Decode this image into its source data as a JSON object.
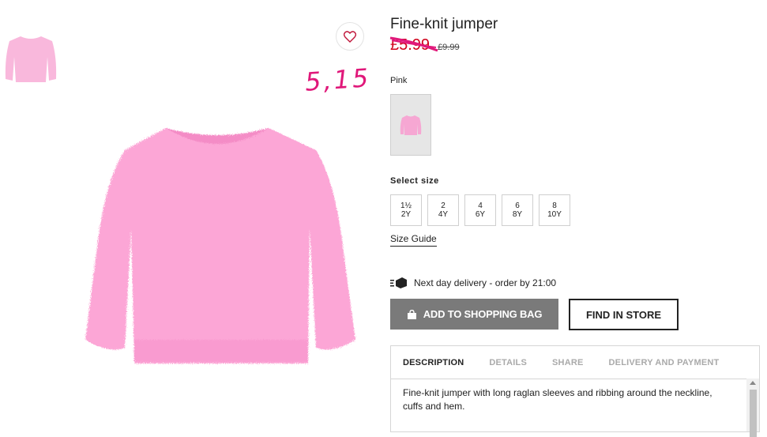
{
  "product": {
    "title": "Fine-knit jumper",
    "price_new": "£5.99",
    "price_old": "£9.99",
    "handwritten_note": "5,15",
    "color_name": "Pink",
    "accent_color": "#d0021b",
    "note_color": "#e0187a"
  },
  "size": {
    "label": "Select size",
    "options": [
      {
        "line1": "1½",
        "line2": "2Y"
      },
      {
        "line1": "2",
        "line2": "4Y"
      },
      {
        "line1": "4",
        "line2": "6Y"
      },
      {
        "line1": "6",
        "line2": "8Y"
      },
      {
        "line1": "8",
        "line2": "10Y"
      }
    ],
    "guide": "Size Guide"
  },
  "delivery": {
    "text": "Next day delivery - order by 21:00",
    "icon": "truck-icon"
  },
  "actions": {
    "add_to_bag": "ADD TO SHOPPING BAG",
    "find_in_store": "FIND IN STORE"
  },
  "tabs": [
    "DESCRIPTION",
    "DETAILS",
    "SHARE",
    "DELIVERY AND PAYMENT"
  ],
  "description": "Fine-knit jumper with long raglan sleeves and ribbing around the neckline, cuffs and hem."
}
